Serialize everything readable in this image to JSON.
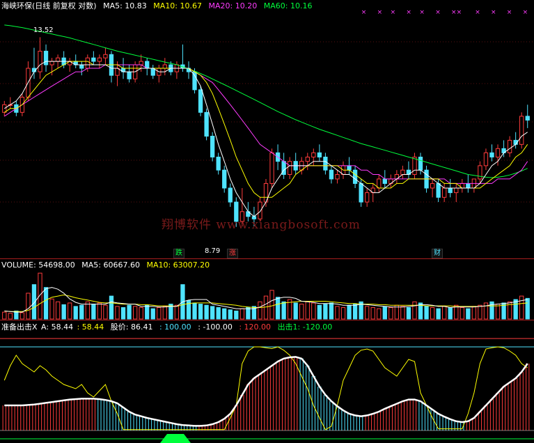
{
  "main_panel": {
    "stock_label": "海峡环保(日线 前复权 对数)",
    "ma5_label": "MA5: 10.83",
    "ma10_label": "MA10: 10.67",
    "ma20_label": "MA20: 10.20",
    "ma60_label": "MA60: 10.16",
    "high_label": "13.52",
    "low_label": "8.79",
    "signal_fall": "跌",
    "signal_rise": "涨",
    "signal_wealth": "财",
    "watermark": "翔博软件 www.xiangbosoft.com"
  },
  "volume_panel": {
    "volume_label": "VOLUME: 54698.00",
    "ma5_label": "MA5: 60667.60",
    "ma10_label": "MA10: 63007.20"
  },
  "indicator_panel": {
    "name_label": "准备出击X",
    "a_label": "A: 58.44",
    "a2_label": ": 58.44",
    "price_label": "股价: 86.41",
    "v100_label": ": 100.00",
    "vneg100_label": ": -100.00",
    "v120_label": ": 120.00",
    "chuji_label": "出击1: -120.00"
  },
  "colors": {
    "up": "#ff3c3c",
    "down": "#4fe3ff",
    "ma5": "#ffffff",
    "ma10": "#ffff00",
    "ma20": "#ff3cff",
    "ma60": "#00ff3c",
    "separator": "#aa1e1e"
  },
  "chart_data": [
    {
      "type": "candlestick",
      "scale": "log",
      "candles": [
        [
          11.4,
          11.7,
          11.3,
          11.6
        ],
        [
          11.6,
          11.8,
          11.5,
          11.6
        ],
        [
          11.6,
          11.7,
          11.3,
          11.4
        ],
        [
          11.4,
          11.9,
          11.3,
          11.8
        ],
        [
          11.8,
          12.8,
          11.7,
          12.6
        ],
        [
          12.6,
          13.2,
          12.3,
          12.5
        ],
        [
          12.5,
          13.52,
          12.3,
          13.1
        ],
        [
          13.1,
          13.3,
          12.5,
          12.7
        ],
        [
          12.7,
          12.9,
          12.4,
          12.8
        ],
        [
          12.8,
          13.0,
          12.6,
          12.9
        ],
        [
          12.9,
          13.1,
          12.6,
          12.7
        ],
        [
          12.7,
          12.9,
          12.5,
          12.8
        ],
        [
          12.8,
          13.0,
          12.6,
          12.7
        ],
        [
          12.7,
          12.8,
          12.4,
          12.6
        ],
        [
          12.6,
          13.0,
          12.5,
          12.9
        ],
        [
          12.9,
          13.1,
          12.7,
          12.8
        ],
        [
          12.8,
          13.0,
          12.6,
          12.9
        ],
        [
          12.9,
          13.2,
          12.7,
          13.0
        ],
        [
          13.0,
          13.1,
          12.2,
          12.4
        ],
        [
          12.4,
          12.8,
          12.1,
          12.6
        ],
        [
          12.6,
          12.9,
          12.3,
          12.5
        ],
        [
          12.5,
          12.7,
          12.2,
          12.3
        ],
        [
          12.3,
          12.8,
          12.2,
          12.7
        ],
        [
          12.7,
          13.0,
          12.5,
          12.8
        ],
        [
          12.8,
          12.9,
          12.4,
          12.6
        ],
        [
          12.6,
          12.7,
          12.3,
          12.4
        ],
        [
          12.4,
          12.7,
          12.2,
          12.6
        ],
        [
          12.6,
          12.9,
          12.4,
          12.7
        ],
        [
          12.7,
          12.8,
          12.4,
          12.5
        ],
        [
          12.5,
          12.8,
          12.3,
          12.7
        ],
        [
          12.7,
          13.3,
          12.5,
          12.6
        ],
        [
          12.6,
          12.8,
          12.3,
          12.5
        ],
        [
          12.5,
          12.6,
          11.9,
          12.0
        ],
        [
          12.0,
          12.1,
          11.3,
          11.4
        ],
        [
          11.4,
          11.5,
          10.7,
          10.8
        ],
        [
          10.8,
          10.9,
          10.2,
          10.3
        ],
        [
          10.3,
          10.4,
          9.9,
          10.0
        ],
        [
          10.0,
          10.1,
          9.5,
          9.6
        ],
        [
          9.6,
          9.7,
          9.2,
          9.3
        ],
        [
          9.3,
          9.4,
          8.79,
          8.9
        ],
        [
          8.9,
          9.6,
          8.8,
          9.1
        ],
        [
          9.1,
          9.3,
          8.9,
          9.0
        ],
        [
          9.0,
          9.2,
          8.8,
          8.95
        ],
        [
          8.95,
          9.4,
          8.9,
          9.3
        ],
        [
          9.3,
          9.8,
          9.2,
          9.7
        ],
        [
          9.7,
          10.5,
          9.6,
          10.4
        ],
        [
          10.4,
          10.6,
          10.0,
          10.2
        ],
        [
          10.2,
          10.4,
          9.8,
          9.9
        ],
        [
          9.9,
          10.3,
          9.8,
          10.2
        ],
        [
          10.2,
          10.4,
          9.9,
          10.0
        ],
        [
          10.0,
          10.3,
          9.9,
          10.2
        ],
        [
          10.2,
          10.4,
          10.0,
          10.3
        ],
        [
          10.3,
          10.5,
          10.1,
          10.4
        ],
        [
          10.4,
          10.6,
          10.2,
          10.3
        ],
        [
          10.3,
          10.4,
          9.9,
          10.0
        ],
        [
          10.0,
          10.1,
          9.7,
          9.8
        ],
        [
          9.8,
          10.0,
          9.7,
          9.9
        ],
        [
          9.9,
          10.2,
          9.8,
          10.1
        ],
        [
          10.1,
          10.3,
          9.9,
          10.0
        ],
        [
          10.0,
          10.1,
          9.6,
          9.7
        ],
        [
          9.7,
          9.8,
          9.2,
          9.3
        ],
        [
          9.3,
          9.6,
          9.2,
          9.5
        ],
        [
          9.5,
          9.7,
          9.3,
          9.6
        ],
        [
          9.6,
          9.9,
          9.5,
          9.8
        ],
        [
          9.8,
          10.0,
          9.6,
          9.7
        ],
        [
          9.7,
          9.9,
          9.6,
          9.8
        ],
        [
          9.8,
          10.0,
          9.7,
          9.9
        ],
        [
          9.9,
          10.1,
          9.8,
          10.0
        ],
        [
          10.0,
          10.2,
          9.8,
          9.9
        ],
        [
          9.9,
          10.4,
          9.8,
          10.3
        ],
        [
          10.3,
          10.4,
          9.9,
          10.0
        ],
        [
          10.0,
          10.1,
          9.5,
          9.6
        ],
        [
          9.6,
          9.8,
          9.4,
          9.7
        ],
        [
          9.7,
          9.8,
          9.3,
          9.4
        ],
        [
          9.4,
          9.7,
          9.3,
          9.6
        ],
        [
          9.6,
          9.8,
          9.4,
          9.5
        ],
        [
          9.5,
          9.7,
          9.3,
          9.6
        ],
        [
          9.6,
          9.8,
          9.5,
          9.7
        ],
        [
          9.7,
          9.9,
          9.5,
          9.6
        ],
        [
          9.6,
          9.8,
          9.5,
          9.8
        ],
        [
          9.8,
          10.2,
          9.7,
          10.1
        ],
        [
          10.1,
          10.5,
          10.0,
          10.4
        ],
        [
          10.4,
          10.6,
          10.2,
          10.3
        ],
        [
          10.3,
          10.6,
          10.1,
          10.5
        ],
        [
          10.5,
          10.7,
          10.3,
          10.4
        ],
        [
          10.4,
          10.8,
          10.3,
          10.7
        ],
        [
          10.7,
          10.9,
          10.5,
          10.6
        ],
        [
          10.6,
          11.4,
          10.5,
          11.3
        ],
        [
          11.3,
          11.6,
          11.0,
          11.2
        ]
      ],
      "ma5": [
        11.5,
        11.6,
        11.7,
        11.9,
        12.2,
        12.5,
        12.7,
        12.8,
        12.8,
        12.8,
        12.8,
        12.8,
        12.7,
        12.7,
        12.7,
        12.7,
        12.7,
        12.7,
        12.6,
        12.6,
        12.5,
        12.5,
        12.5,
        12.6,
        12.6,
        12.6,
        12.5,
        12.5,
        12.6,
        12.6,
        12.6,
        12.6,
        12.4,
        12.1,
        11.6,
        11.1,
        10.6,
        10.2,
        9.8,
        9.5,
        9.3,
        9.1,
        9.0,
        9.1,
        9.3,
        9.6,
        9.8,
        10.0,
        10.1,
        10.1,
        10.1,
        10.1,
        10.2,
        10.2,
        10.2,
        10.1,
        10.0,
        9.9,
        9.9,
        9.8,
        9.7,
        9.6,
        9.5,
        9.5,
        9.6,
        9.7,
        9.8,
        9.9,
        9.9,
        10.0,
        10.0,
        9.9,
        9.8,
        9.7,
        9.6,
        9.6,
        9.6,
        9.6,
        9.6,
        9.6,
        9.7,
        9.9,
        10.1,
        10.2,
        10.4,
        10.5,
        10.6,
        10.8,
        10.9
      ],
      "ma10": [
        11.4,
        11.5,
        11.5,
        11.6,
        11.8,
        12.0,
        12.2,
        12.4,
        12.5,
        12.6,
        12.7,
        12.8,
        12.8,
        12.8,
        12.8,
        12.7,
        12.7,
        12.7,
        12.7,
        12.7,
        12.6,
        12.6,
        12.6,
        12.6,
        12.6,
        12.6,
        12.6,
        12.6,
        12.6,
        12.6,
        12.6,
        12.6,
        12.5,
        12.4,
        12.2,
        11.9,
        11.5,
        11.1,
        10.7,
        10.3,
        10.0,
        9.7,
        9.5,
        9.4,
        9.4,
        9.4,
        9.5,
        9.6,
        9.7,
        9.9,
        10.0,
        10.1,
        10.1,
        10.1,
        10.1,
        10.1,
        10.1,
        10.0,
        10.0,
        9.9,
        9.8,
        9.7,
        9.7,
        9.6,
        9.6,
        9.6,
        9.7,
        9.7,
        9.8,
        9.8,
        9.8,
        9.8,
        9.8,
        9.8,
        9.7,
        9.7,
        9.7,
        9.6,
        9.6,
        9.6,
        9.6,
        9.7,
        9.8,
        9.9,
        10.0,
        10.1,
        10.3,
        10.4,
        10.6
      ],
      "ma20": [
        11.3,
        11.4,
        11.5,
        11.6,
        11.7,
        11.8,
        11.9,
        12.0,
        12.1,
        12.2,
        12.3,
        12.4,
        12.5,
        12.5,
        12.6,
        12.6,
        12.6,
        12.7,
        12.7,
        12.7,
        12.7,
        12.7,
        12.7,
        12.7,
        12.6,
        12.6,
        12.6,
        12.6,
        12.6,
        12.6,
        12.6,
        12.6,
        12.5,
        12.4,
        12.3,
        12.2,
        12.0,
        11.8,
        11.6,
        11.4,
        11.2,
        11.0,
        10.8,
        10.6,
        10.5,
        10.4,
        10.3,
        10.2,
        10.1,
        10.1,
        10.1,
        10.1,
        10.1,
        10.1,
        10.1,
        10.1,
        10.1,
        10.1,
        10.1,
        10.1,
        10.0,
        10.0,
        9.9,
        9.9,
        9.8,
        9.8,
        9.8,
        9.8,
        9.8,
        9.8,
        9.8,
        9.8,
        9.8,
        9.8,
        9.8,
        9.7,
        9.7,
        9.7,
        9.7,
        9.7,
        9.7,
        9.7,
        9.7,
        9.8,
        9.8,
        9.8,
        9.9,
        10.0,
        10.2
      ],
      "ma60": [
        13.9,
        13.88,
        13.85,
        13.82,
        13.78,
        13.74,
        13.7,
        13.66,
        13.62,
        13.58,
        13.54,
        13.5,
        13.45,
        13.4,
        13.35,
        13.3,
        13.25,
        13.2,
        13.15,
        13.1,
        13.06,
        13.02,
        12.98,
        12.94,
        12.9,
        12.86,
        12.82,
        12.78,
        12.74,
        12.7,
        12.64,
        12.58,
        12.52,
        12.45,
        12.38,
        12.3,
        12.22,
        12.14,
        12.06,
        11.98,
        11.9,
        11.82,
        11.74,
        11.66,
        11.58,
        11.5,
        11.42,
        11.35,
        11.28,
        11.21,
        11.15,
        11.09,
        11.03,
        10.97,
        10.92,
        10.87,
        10.82,
        10.77,
        10.72,
        10.67,
        10.62,
        10.58,
        10.54,
        10.5,
        10.46,
        10.42,
        10.38,
        10.34,
        10.3,
        10.26,
        10.22,
        10.18,
        10.14,
        10.1,
        10.06,
        10.02,
        9.98,
        9.94,
        9.9,
        9.88,
        9.86,
        9.84,
        9.83,
        9.84,
        9.86,
        9.89,
        9.93,
        9.98,
        10.04
      ]
    },
    {
      "type": "bar",
      "volumes": [
        12,
        10,
        14,
        11,
        45,
        60,
        80,
        55,
        35,
        30,
        25,
        28,
        22,
        24,
        30,
        26,
        28,
        24,
        40,
        22,
        20,
        24,
        22,
        20,
        24,
        18,
        20,
        22,
        26,
        24,
        60,
        32,
        28,
        26,
        24,
        22,
        20,
        18,
        16,
        14,
        18,
        20,
        22,
        30,
        40,
        50,
        38,
        30,
        34,
        28,
        26,
        30,
        28,
        24,
        26,
        28,
        22,
        20,
        24,
        26,
        30,
        22,
        20,
        18,
        22,
        20,
        24,
        22,
        20,
        30,
        28,
        22,
        20,
        18,
        22,
        20,
        24,
        20,
        18,
        22,
        24,
        28,
        30,
        26,
        28,
        30,
        34,
        40,
        36
      ],
      "ma5": [
        14,
        13,
        12,
        12,
        18,
        28,
        42,
        53,
        55,
        52,
        45,
        35,
        29,
        26,
        26,
        26,
        26,
        26,
        30,
        28,
        27,
        26,
        26,
        22,
        22,
        22,
        21,
        21,
        22,
        22,
        30,
        33,
        34,
        34,
        34,
        26,
        24,
        22,
        20,
        18,
        18,
        18,
        18,
        21,
        26,
        32,
        36,
        38,
        38,
        36,
        31,
        30,
        29,
        27,
        27,
        27,
        26,
        24,
        24,
        24,
        26,
        25,
        24,
        23,
        22,
        21,
        21,
        21,
        22,
        23,
        25,
        25,
        24,
        22,
        22,
        20,
        21,
        21,
        21,
        21,
        22,
        23,
        25,
        26,
        27,
        28,
        30,
        32,
        34
      ],
      "ma10": [
        14,
        13,
        13,
        13,
        15,
        20,
        27,
        33,
        38,
        40,
        42,
        40,
        37,
        35,
        33,
        31,
        29,
        28,
        28,
        27,
        26,
        26,
        26,
        25,
        25,
        24,
        23,
        23,
        23,
        22,
        25,
        27,
        28,
        28,
        28,
        28,
        27,
        26,
        25,
        24,
        22,
        21,
        20,
        20,
        21,
        23,
        26,
        28,
        29,
        30,
        31,
        31,
        31,
        31,
        31,
        30,
        29,
        28,
        27,
        27,
        26,
        26,
        26,
        25,
        25,
        24,
        24,
        24,
        24,
        24,
        24,
        23,
        23,
        23,
        23,
        23,
        22,
        22,
        22,
        22,
        22,
        23,
        23,
        23,
        24,
        25,
        26,
        27,
        28
      ]
    },
    {
      "type": "line",
      "white": [
        -40,
        -40,
        -40,
        -40,
        -39,
        -38,
        -36,
        -34,
        -32,
        -30,
        -28,
        -26,
        -25,
        -24,
        -24,
        -24,
        -25,
        -27,
        -30,
        -35,
        -45,
        -55,
        -62,
        -66,
        -70,
        -73,
        -76,
        -79,
        -82,
        -85,
        -87,
        -88,
        -89,
        -89,
        -88,
        -85,
        -80,
        -72,
        -60,
        -40,
        -15,
        10,
        25,
        35,
        45,
        55,
        65,
        72,
        75,
        76,
        72,
        55,
        30,
        5,
        -15,
        -30,
        -42,
        -52,
        -60,
        -64,
        -66,
        -64,
        -60,
        -55,
        -48,
        -42,
        -36,
        -30,
        -26,
        -26,
        -30,
        -40,
        -50,
        -60,
        -67,
        -73,
        -78,
        -80,
        -78,
        -70,
        -55,
        -40,
        -25,
        -10,
        5,
        15,
        25,
        40,
        60
      ],
      "yellow": [
        20,
        55,
        80,
        60,
        50,
        40,
        55,
        45,
        30,
        20,
        10,
        5,
        0,
        10,
        -10,
        -20,
        -5,
        10,
        -30,
        -60,
        -98,
        -98,
        -98,
        -98,
        -98,
        -98,
        -98,
        -98,
        -98,
        -98,
        -98,
        -98,
        -98,
        -98,
        -98,
        -98,
        -98,
        -98,
        -70,
        -40,
        60,
        90,
        100,
        100,
        98,
        96,
        100,
        92,
        80,
        60,
        30,
        0,
        -40,
        -70,
        -98,
        -90,
        -40,
        20,
        50,
        80,
        92,
        95,
        90,
        70,
        50,
        40,
        30,
        50,
        70,
        65,
        -10,
        -40,
        -70,
        -96,
        -96,
        -96,
        -96,
        -96,
        -60,
        -10,
        60,
        95,
        98,
        100,
        98,
        90,
        80,
        60,
        50
      ]
    }
  ]
}
